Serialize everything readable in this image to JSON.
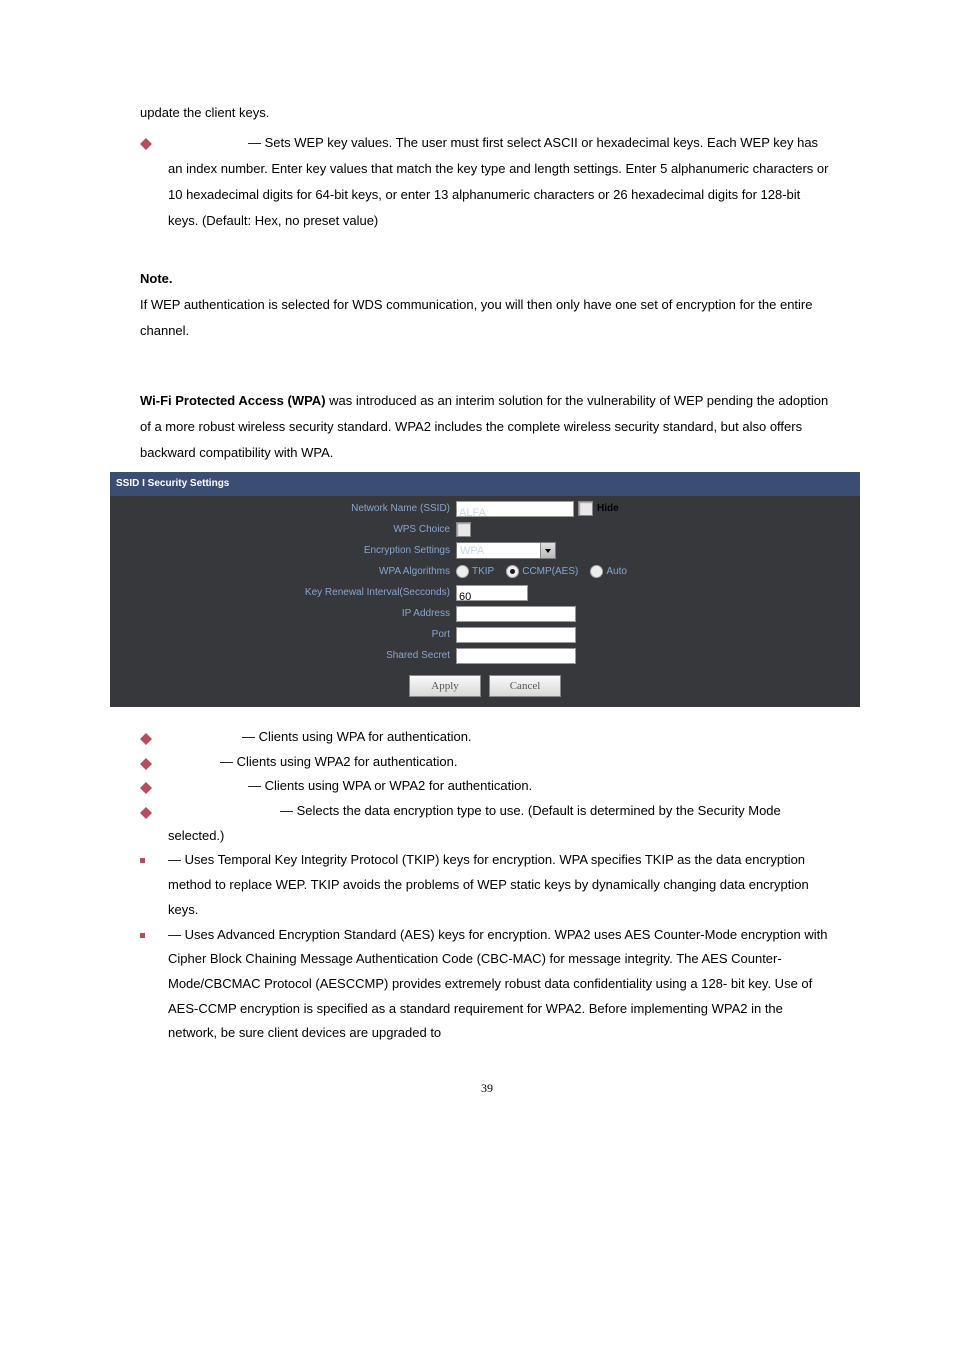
{
  "intro_text": "update the client keys.",
  "wep_keys_bullet": "— Sets WEP key values. The user must first select ASCII or hexadecimal keys. Each WEP key has an index number. Enter key values that match the key type and length settings. Enter 5 alphanumeric characters or 10 hexadecimal digits for 64-bit keys, or enter 13 alphanumeric characters or 26 hexadecimal digits for 128-bit keys. (Default: Hex, no preset value)",
  "note_label": "Note",
  "note_text": "If WEP authentication is selected for WDS communication, you will then only have one set of encryption for the entire channel.",
  "wpa_heading": "Wi-Fi Protected Access (WPA)",
  "wpa_intro": " was introduced as an interim solution for the vulnerability of WEP pending the adoption of a more robust wireless security standard. WPA2 includes the complete wireless security standard, but also offers backward compatibility with WPA.",
  "panel": {
    "title": "SSID I Security Settings",
    "rows": {
      "network_name_label": "Network Name (SSID)",
      "network_name_value": "ALFA",
      "hide_label": "Hide",
      "wps_choice_label": "WPS Choice",
      "encryption_label": "Encryption Settings",
      "encryption_value": "WPA",
      "wpa_alg_label": "WPA Algorithms",
      "tkip": "TKIP",
      "ccmp": "CCMP(AES)",
      "auto": "Auto",
      "key_renewal_label": "Key Renewal Interval(Secconds)",
      "key_renewal_value": "60",
      "ip_label": "IP Address",
      "port_label": "Port",
      "shared_secret_label": "Shared Secret",
      "apply": "Apply",
      "cancel": "Cancel"
    }
  },
  "lower": {
    "b1": "— Clients using WPA for authentication.",
    "b2": "— Clients using WPA2 for authentication.",
    "b3": "— Clients using WPA or WPA2 for authentication.",
    "b4": "— Selects the data encryption type to use. (Default is determined by the Security Mode selected.)",
    "sb1": "— Uses Temporal Key Integrity Protocol (TKIP) keys for encryption. WPA specifies TKIP as the data encryption method to replace WEP. TKIP avoids the problems of WEP static keys by dynamically changing data encryption keys.",
    "sb2": "— Uses Advanced Encryption Standard (AES) keys for encryption. WPA2 uses AES Counter-Mode encryption with Cipher Block Chaining Message Authentication Code (CBC-MAC) for message integrity. The AES Counter-Mode/CBCMAC Protocol (AESCCMP) provides extremely robust data confidentiality using a 128- bit key. Use of AES-CCMP encryption is specified as a standard requirement for WPA2. Before implementing WPA2 in the network, be sure client devices are upgraded to"
  },
  "page_number": "39"
}
